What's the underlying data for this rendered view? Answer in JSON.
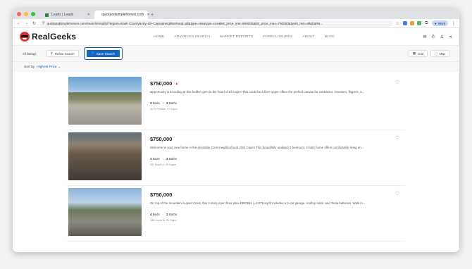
{
  "browser": {
    "tabs": [
      {
        "title": "Leads | Leads",
        "active": false,
        "favicon_color": "#3b7a3b"
      },
      {
        "title": "quickandsimplehomes.com",
        "active": true,
        "favicon_color": "#e5772a"
      }
    ],
    "new_tab": "+",
    "url": "quickandsimplehomes.com/search/results/?region=East+County&city=El+Cajon&neighborhood=all&type=res&type=con&list_price_min=600000&list_price_max=750000&beds_min=all&baths...",
    "profile_label": "Work"
  },
  "site": {
    "logo_text": "RealGeeks",
    "nav": [
      "HOME",
      "ADVANCED SEARCH",
      "MARKET REPORTS",
      "FORECLOSURES",
      "ABOUT",
      "BLOG"
    ],
    "header_icons": [
      "mail-icon",
      "phone-icon",
      "user-icon",
      "share-icon"
    ]
  },
  "filterbar": {
    "all_listings": "All listings",
    "refine": "Refine Search",
    "save": "Save Search",
    "grid": "Grid",
    "map": "Map"
  },
  "sort": {
    "label": "Sort by",
    "value": "Highest Price"
  },
  "listings": [
    {
      "price": "$750,000",
      "trend": "up",
      "desc": "Opportunity is knocking at this hidden gem in the heart of El Cajon! This could be a fixer-upper offers the perfect canvas for contractor, investors, flippers, a...",
      "beds": "3",
      "beds_label": "Beds",
      "baths": "2",
      "baths_label": "Baths",
      "address": "1173 Pelham, El Cajon"
    },
    {
      "price": "$750,000",
      "trend": "",
      "desc": "Welcome to your new home in the desirable Crest neighborhood of El Cajon! This beautifully updated 2-bedroom, 2-bath home offers comfortable living en...",
      "beds": "3",
      "beds_label": "Beds",
      "baths": "2",
      "baths_label": "Baths",
      "address": "101 Noel Ln, El Cajon"
    },
    {
      "price": "$750,000",
      "trend": "",
      "desc": "On top of the mountain in quiet Crest, this 2-story open floor plan 4BR/3BA (~2,076 sq ft) includes a 2-car garage, rooftop solar, and Tesla batteries. Walk in...",
      "beds": "4",
      "beds_label": "Beds",
      "baths": "2",
      "baths_label": "Baths",
      "address": "186 Linda St, El Cajon"
    }
  ],
  "colors": {
    "brand_red": "#d7332e",
    "accent_blue": "#1266c4"
  }
}
